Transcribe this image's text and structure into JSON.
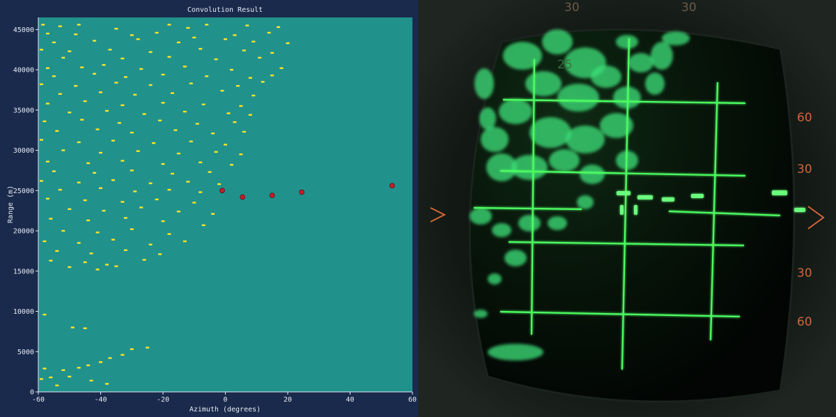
{
  "chart_data": {
    "type": "heatmap",
    "title": "Convolution Result",
    "xlabel": "Azimuth (degrees)",
    "ylabel": "Range (m)",
    "xlim": [
      -60,
      60
    ],
    "ylim": [
      0,
      46500
    ],
    "x_ticks": [
      -60,
      -40,
      -20,
      0,
      20,
      40,
      60
    ],
    "y_ticks": [
      0,
      5000,
      10000,
      15000,
      20000,
      25000,
      30000,
      35000,
      40000,
      45000
    ],
    "grid": false,
    "background_color": "#21918c",
    "cell_color": "#fde725",
    "marker_color": "#d01a2a",
    "detections": [
      {
        "azimuth": -1,
        "range": 25000
      },
      {
        "azimuth": 5.5,
        "range": 24200
      },
      {
        "azimuth": 15,
        "range": 24400
      },
      {
        "azimuth": 24.5,
        "range": 24800
      },
      {
        "azimuth": 53.5,
        "range": 25600
      }
    ],
    "clutter_cells": [
      [
        -58.5,
        45600
      ],
      [
        -53,
        45400
      ],
      [
        -47,
        45600
      ],
      [
        -35,
        45100
      ],
      [
        -18,
        45600
      ],
      [
        -12,
        45200
      ],
      [
        -6,
        45600
      ],
      [
        7,
        45500
      ],
      [
        17,
        45300
      ],
      [
        -57,
        44500
      ],
      [
        -48,
        44400
      ],
      [
        -30,
        44300
      ],
      [
        -22,
        44600
      ],
      [
        -10,
        44000
      ],
      [
        3,
        44300
      ],
      [
        14,
        44600
      ],
      [
        -55,
        43400
      ],
      [
        -42,
        43600
      ],
      [
        -28,
        43800
      ],
      [
        -15,
        43400
      ],
      [
        0,
        43800
      ],
      [
        9,
        43500
      ],
      [
        20,
        43300
      ],
      [
        -59,
        42500
      ],
      [
        -50,
        42300
      ],
      [
        -37,
        42500
      ],
      [
        -24,
        42200
      ],
      [
        -8,
        42600
      ],
      [
        6,
        42400
      ],
      [
        15,
        42100
      ],
      [
        -52,
        41500
      ],
      [
        -33,
        41400
      ],
      [
        -18,
        41600
      ],
      [
        -3,
        41300
      ],
      [
        11,
        41500
      ],
      [
        -57,
        40200
      ],
      [
        -46,
        40300
      ],
      [
        -39,
        40600
      ],
      [
        -27,
        40100
      ],
      [
        -13,
        40400
      ],
      [
        2,
        40000
      ],
      [
        18,
        40200
      ],
      [
        -55,
        39200
      ],
      [
        -42,
        39500
      ],
      [
        -32,
        39100
      ],
      [
        -20,
        39400
      ],
      [
        -6,
        39200
      ],
      [
        8,
        39000
      ],
      [
        15,
        39300
      ],
      [
        -59,
        38200
      ],
      [
        -48,
        38000
      ],
      [
        -35,
        38400
      ],
      [
        -24,
        38100
      ],
      [
        -11,
        38300
      ],
      [
        4,
        38000
      ],
      [
        12,
        38500
      ],
      [
        -53,
        37000
      ],
      [
        -40,
        37200
      ],
      [
        -29,
        36900
      ],
      [
        -17,
        37100
      ],
      [
        -1,
        37400
      ],
      [
        9,
        36800
      ],
      [
        -57,
        35800
      ],
      [
        -45,
        36100
      ],
      [
        -33,
        35600
      ],
      [
        -20,
        35900
      ],
      [
        -7,
        35700
      ],
      [
        5,
        35500
      ],
      [
        -50,
        34700
      ],
      [
        -38,
        34900
      ],
      [
        -26,
        34500
      ],
      [
        -13,
        34800
      ],
      [
        1,
        34600
      ],
      [
        8,
        34400
      ],
      [
        -58,
        33600
      ],
      [
        -46,
        33800
      ],
      [
        -34,
        33400
      ],
      [
        -21,
        33700
      ],
      [
        -9,
        33300
      ],
      [
        3,
        33500
      ],
      [
        -54,
        32400
      ],
      [
        -41,
        32600
      ],
      [
        -30,
        32200
      ],
      [
        -16,
        32500
      ],
      [
        -4,
        32100
      ],
      [
        6,
        32300
      ],
      [
        -59,
        31300
      ],
      [
        -47,
        31000
      ],
      [
        -36,
        31200
      ],
      [
        -23,
        30900
      ],
      [
        -11,
        31100
      ],
      [
        0,
        30700
      ],
      [
        -52,
        30000
      ],
      [
        -40,
        29700
      ],
      [
        -28,
        29900
      ],
      [
        -15,
        29600
      ],
      [
        -3,
        29800
      ],
      [
        5,
        29500
      ],
      [
        -57,
        28600
      ],
      [
        -44,
        28400
      ],
      [
        -33,
        28700
      ],
      [
        -20,
        28300
      ],
      [
        -8,
        28500
      ],
      [
        2,
        28200
      ],
      [
        -55,
        27400
      ],
      [
        -42,
        27200
      ],
      [
        -30,
        27500
      ],
      [
        -17,
        27100
      ],
      [
        -5,
        27300
      ],
      [
        -59,
        26200
      ],
      [
        -47,
        26000
      ],
      [
        -36,
        26300
      ],
      [
        -24,
        25900
      ],
      [
        -12,
        26100
      ],
      [
        -2,
        25800
      ],
      [
        -53,
        25100
      ],
      [
        -40,
        25300
      ],
      [
        -29,
        24900
      ],
      [
        -18,
        25100
      ],
      [
        -8,
        24800
      ],
      [
        -57,
        24000
      ],
      [
        -45,
        23800
      ],
      [
        -33,
        23600
      ],
      [
        -22,
        23900
      ],
      [
        -10,
        23500
      ],
      [
        -50,
        22700
      ],
      [
        -39,
        22500
      ],
      [
        -27,
        22900
      ],
      [
        -15,
        22400
      ],
      [
        -4,
        22100
      ],
      [
        -56,
        21500
      ],
      [
        -44,
        21300
      ],
      [
        -32,
        21600
      ],
      [
        -20,
        21200
      ],
      [
        -7,
        20700
      ],
      [
        -52,
        20000
      ],
      [
        -41,
        19800
      ],
      [
        -30,
        20200
      ],
      [
        -18,
        19600
      ],
      [
        -58,
        18700
      ],
      [
        -47,
        18500
      ],
      [
        -36,
        18900
      ],
      [
        -24,
        18300
      ],
      [
        -13,
        18700
      ],
      [
        -54,
        17500
      ],
      [
        -43,
        17200
      ],
      [
        -32,
        17600
      ],
      [
        -21,
        17100
      ],
      [
        -56,
        16300
      ],
      [
        -45,
        16100
      ],
      [
        -38,
        15800
      ],
      [
        -26,
        16400
      ],
      [
        -50,
        15500
      ],
      [
        -41,
        15200
      ],
      [
        -35,
        15600
      ],
      [
        -58,
        9600
      ],
      [
        -49,
        8000
      ],
      [
        -45,
        7900
      ],
      [
        -33,
        4600
      ],
      [
        -30,
        5300
      ],
      [
        -25,
        5500
      ],
      [
        -37,
        4200
      ],
      [
        -40,
        3700
      ],
      [
        -44,
        3300
      ],
      [
        -47,
        3000
      ],
      [
        -52,
        2700
      ],
      [
        -58,
        2900
      ],
      [
        -56,
        1800
      ],
      [
        -43,
        1400
      ],
      [
        -38,
        1000
      ],
      [
        -54,
        800
      ],
      [
        -50,
        1900
      ],
      [
        -59,
        1600
      ]
    ]
  }
}
